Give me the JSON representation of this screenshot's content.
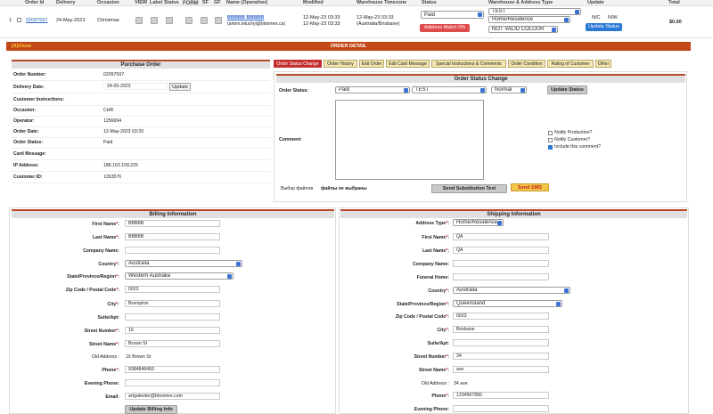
{
  "header": {
    "cols": [
      "Order Id",
      "Delivery",
      "Occasion",
      "VIEW",
      "Label",
      "Status",
      "FORM",
      "SF",
      "GF",
      "Name (Operation)",
      "Modified",
      "Warehouse Timezone",
      "Status",
      "Warehouse & Address Type",
      "Update",
      "Total"
    ]
  },
  "order_row": {
    "num": "1",
    "order_id": "02097597",
    "delivery": "24-May-2023",
    "occasion": "Christmas",
    "name": "BBBBB BBBBB",
    "email": "(artem.letuchyi@bloomex.ca)",
    "modified": "12-May-23 03:33",
    "modified2": "12-May-23 03:33",
    "wh_time": "12-May-23 03:33",
    "wh_zone": "(Australia/Brisbane)",
    "status_select": "Paid",
    "address_match": "Address Match 0%",
    "warehouse": "TEST",
    "address_type": "Home/Residence",
    "colour": "NOT VALID COLOUR",
    "nc": "N/C",
    "nw": "N/W",
    "update_status": "Update Status",
    "total": "$0.00"
  },
  "detail": {
    "close": "(X)Close",
    "title": "ORDER DETAIL"
  },
  "purchase_order": {
    "title": "Purchase Order",
    "rows": [
      {
        "label": "Order Number:",
        "value": "02097597"
      },
      {
        "label": "Delivery Date:",
        "value": "24-05-2023"
      },
      {
        "label": "Customer Instructions:",
        "value": ""
      },
      {
        "label": "Occasion:",
        "value": "CHR"
      },
      {
        "label": "Operator:",
        "value": "1256694"
      },
      {
        "label": "Order Date:",
        "value": "12-May-2023 03:33"
      },
      {
        "label": "Order Status:",
        "value": "Paid"
      },
      {
        "label": "Card Message:",
        "value": ""
      },
      {
        "label": "IP Address:",
        "value": "188.163.109.225"
      },
      {
        "label": "Customer ID:",
        "value": "1263576"
      }
    ],
    "update": "Update"
  },
  "tabs": [
    "Order Status Change",
    "Order History",
    "Edit Order",
    "Edit Card Message",
    "Special Instructions & Comments",
    "Order Condition",
    "Rating of Customer",
    "Other"
  ],
  "status_change": {
    "title": "Order Status Change",
    "status_label": "Order Status:",
    "status_val": "Paid",
    "wh_val": "TEST",
    "priority_val": "Normal",
    "update_btn": "Update Status",
    "comment_label": "Comment:",
    "notify_production": "Notify Production?",
    "notify_customer": "Notify Customer?",
    "include_comment": "Include this comment?",
    "file_choose": "Выбор файлов",
    "file_none": "файлы не выбраны",
    "send_sub": "Send Substitution Text",
    "send_sms": "Send SMS"
  },
  "billing": {
    "title": "Billing Information",
    "first_name_l": "First Name",
    "first_name": "BBBBB",
    "last_name_l": "Last Name",
    "last_name": "BBBBB",
    "company_l": "Company Name:",
    "country_l": "Country",
    "country": "Australia",
    "state_l": "State/Province/Region",
    "state": "Western Australia",
    "zip_l": "Zip Code / Postal Code",
    "zip": "0023",
    "city_l": "City",
    "city": "Brompton",
    "suite_l": "Suite/Apt:",
    "street_num_l": "Street Number",
    "street_num": "16",
    "street_name_l": "Street Name",
    "street_name": "Brown St",
    "old_address_l": "Old Address :",
    "old_address": "16 Brown St",
    "phone_l": "Phone",
    "phone": "9384848493",
    "evening_l": "Evening Phone:",
    "email_l": "Email:",
    "email": "artgatester@bloomex.com",
    "update_btn": "Update Billing Info"
  },
  "shipping": {
    "title": "Shipping Information",
    "addr_type_l": "Address Type",
    "addr_type": "Home/Residence",
    "first_name_l": "First Name",
    "first_name": "QA",
    "last_name_l": "Last Name",
    "last_name": "QA",
    "company_l": "Company Name:",
    "funeral_l": "Funeral Home:",
    "country_l": "Country",
    "country": "Australia",
    "state_l": "State/Province/Region",
    "state": "Queensland",
    "zip_l": "Zip Code / Postal Code",
    "zip": "0023",
    "city_l": "City",
    "city": "Brisbane",
    "suite_l": "Suite/Apt:",
    "street_num_l": "Street Number",
    "street_num": "34",
    "street_name_l": "Street Name",
    "street_name": "ave",
    "old_address_l": "Old Address :",
    "old_address": "34 ave",
    "phone_l": "Phone",
    "phone": "1234567890",
    "evening_l": "Evening Phone:"
  },
  "colors": {
    "accent": "#c24818",
    "blue": "#2a78d6",
    "red": "#de4c4c",
    "tab": "#f3e6b0"
  }
}
